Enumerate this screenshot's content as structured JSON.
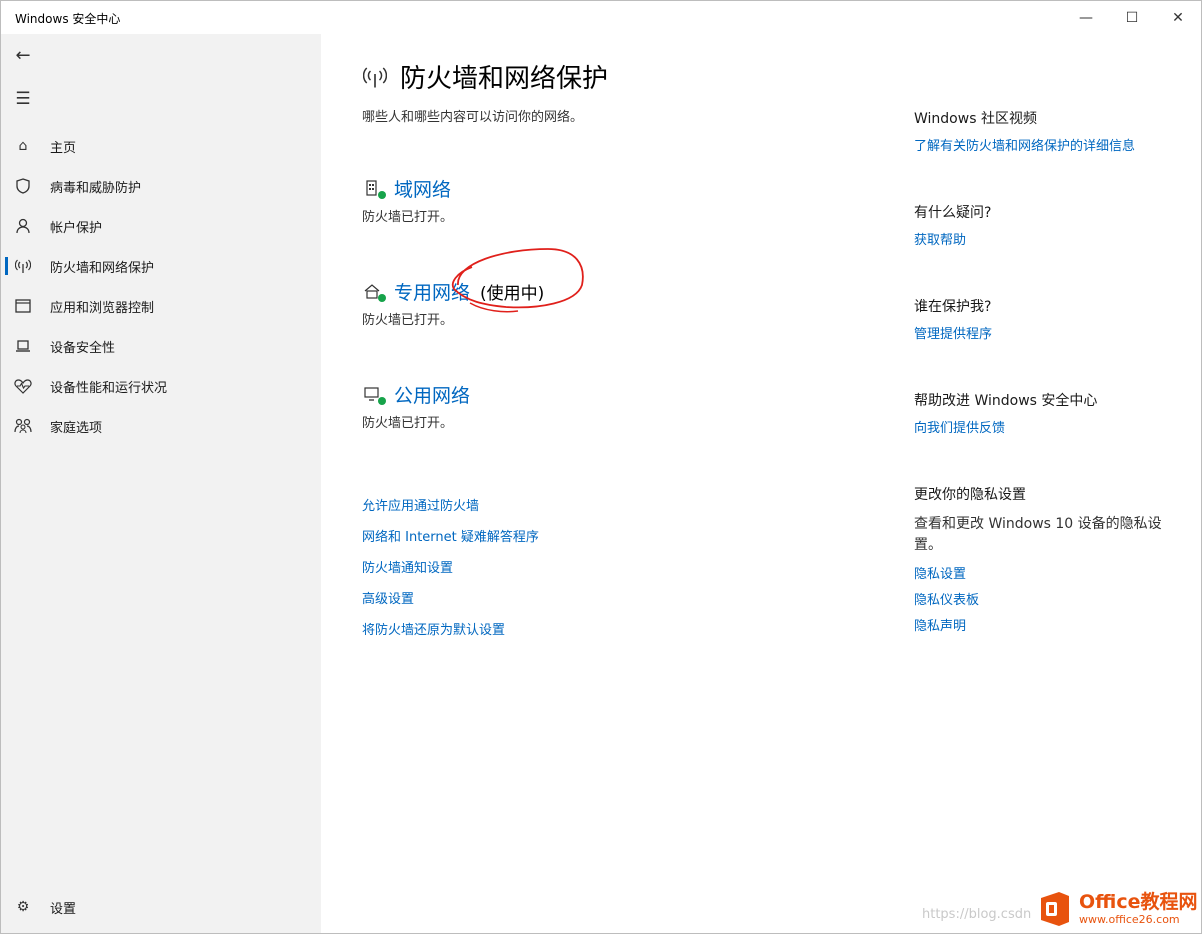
{
  "window": {
    "title": "Windows 安全中心"
  },
  "sidebar": {
    "items": [
      {
        "label": "主页",
        "icon": "home-icon"
      },
      {
        "label": "病毒和威胁防护",
        "icon": "shield-icon"
      },
      {
        "label": "帐户保护",
        "icon": "person-icon"
      },
      {
        "label": "防火墙和网络保护",
        "icon": "wifi-signal-icon",
        "active": true
      },
      {
        "label": "应用和浏览器控制",
        "icon": "app-window-icon"
      },
      {
        "label": "设备安全性",
        "icon": "laptop-icon"
      },
      {
        "label": "设备性能和运行状况",
        "icon": "heart-pulse-icon"
      },
      {
        "label": "家庭选项",
        "icon": "family-icon"
      }
    ],
    "settings_label": "设置"
  },
  "main": {
    "title": "防火墙和网络保护",
    "subtitle": "哪些人和哪些内容可以访问你的网络。",
    "networks": [
      {
        "name": "域网络",
        "status": "防火墙已打开。",
        "in_use": ""
      },
      {
        "name": "专用网络",
        "status": "防火墙已打开。",
        "in_use": "(使用中)"
      },
      {
        "name": "公用网络",
        "status": "防火墙已打开。",
        "in_use": ""
      }
    ],
    "links": [
      "允许应用通过防火墙",
      "网络和 Internet 疑难解答程序",
      "防火墙通知设置",
      "高级设置",
      "将防火墙还原为默认设置"
    ]
  },
  "right": {
    "community_heading": "Windows 社区视频",
    "community_link": "了解有关防火墙和网络保护的详细信息",
    "question_heading": "有什么疑问?",
    "question_link": "获取帮助",
    "protect_heading": "谁在保护我?",
    "protect_link": "管理提供程序",
    "improve_heading": "帮助改进 Windows 安全中心",
    "improve_link": "向我们提供反馈",
    "privacy_heading": "更改你的隐私设置",
    "privacy_text": "查看和更改 Windows 10 设备的隐私设置。",
    "privacy_links": [
      "隐私设置",
      "隐私仪表板",
      "隐私声明"
    ]
  },
  "watermark": {
    "url_text": "https://blog.csdn",
    "brand_name": "Office教程网",
    "brand_url": "www.office26.com"
  },
  "colors": {
    "accent": "#0067c0",
    "sidebar_bg": "#f2f2f2",
    "ok_green": "#16a34a",
    "brand_orange": "#e8530e",
    "annotation_red": "#e0201b"
  }
}
